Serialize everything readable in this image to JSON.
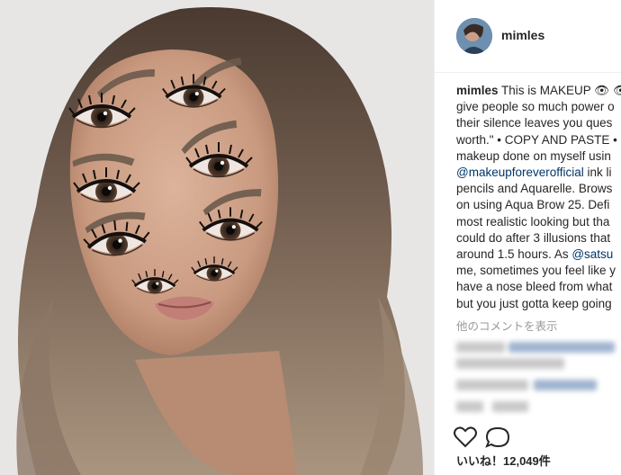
{
  "post": {
    "username": "mimles",
    "caption_user": "mimles",
    "caption_lines": [
      "This is MAKEUP 👁 👁",
      "give people so much power o",
      "their silence leaves you ques",
      "worth.\" • COPY AND PASTE •",
      "makeup done on myself usin",
      "@makeupforeverofficial ink li",
      "pencils and Aquarelle. Brows",
      "on using Aqua Brow 25. Defi",
      "most realistic looking but tha",
      "could do after 3 illusions that",
      "around 1.5 hours. As @satsu",
      "me, sometimes you feel like y",
      "have a nose bleed from what",
      "but you just gotta keep going"
    ],
    "mention_1": "@makeupforeverofficial",
    "mention_1_suffix": " ink li",
    "mention_2_prefix": "around 1.5 hours. As ",
    "mention_2": "@satsu",
    "more_comments": "他のコメントを表示",
    "likes": "いいね！12,049件"
  },
  "icons": [
    "avatar",
    "heart-icon",
    "comment-icon"
  ]
}
